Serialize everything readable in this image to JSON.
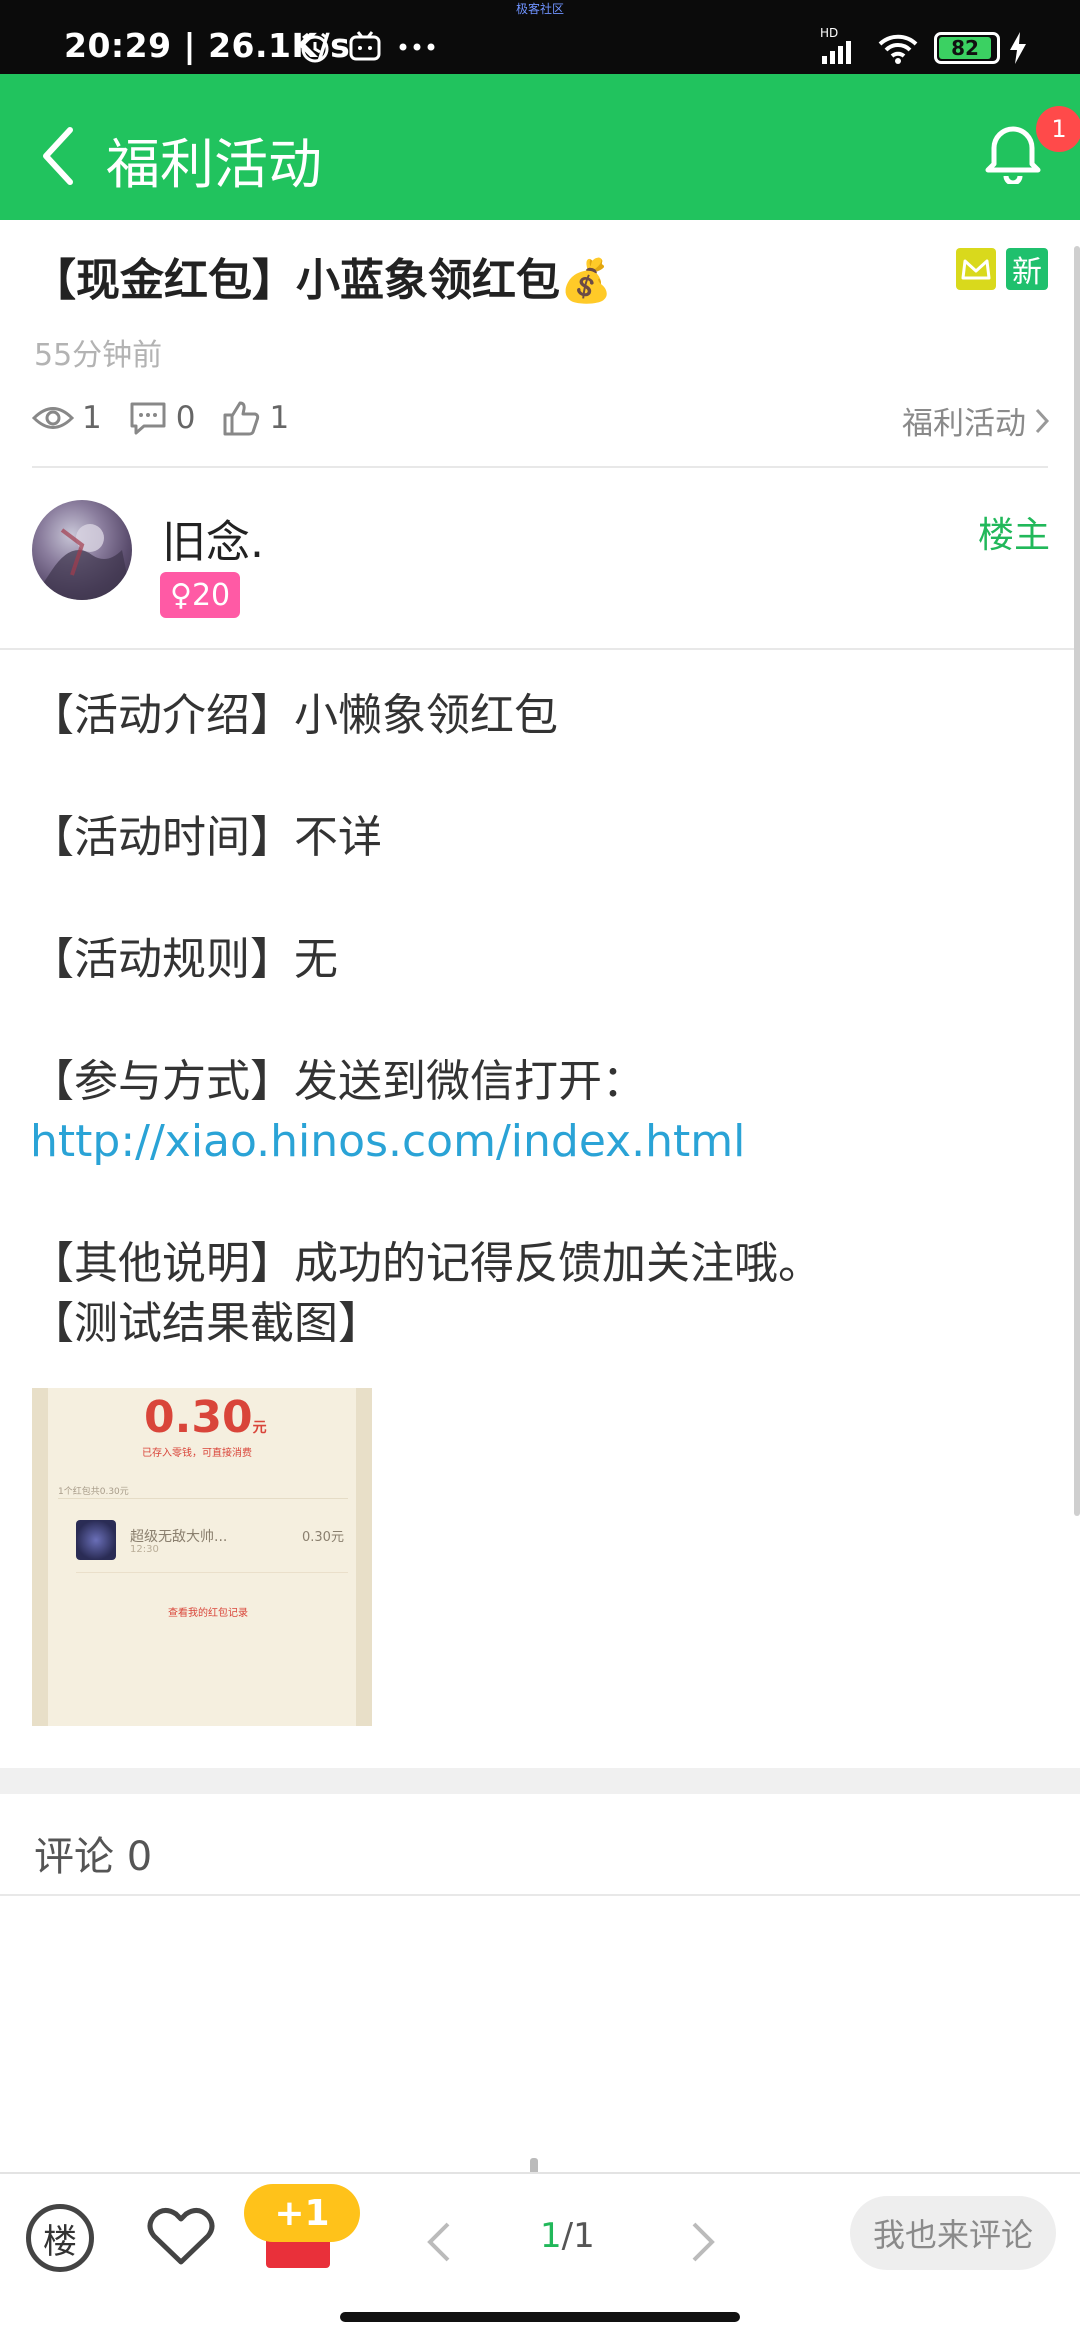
{
  "status_bar": {
    "time": "20:29 | 26.1K/s",
    "tiny_label": "极客社区",
    "battery": "82",
    "network": "HD"
  },
  "header": {
    "title": "福利活动",
    "notification_count": "1"
  },
  "post": {
    "title": "【现金红包】小蓝象领红包",
    "title_emoji": "💰",
    "tag_new": "新",
    "time": "55分钟前",
    "views": "1",
    "comments": "0",
    "likes": "1",
    "category": "福利活动"
  },
  "author": {
    "name": "旧念.",
    "gender_level": "♀20",
    "role": "楼主"
  },
  "content": {
    "intro": "【活动介绍】小懒象领红包",
    "time": "【活动时间】不详",
    "rules": "【活动规则】无",
    "method": "【参与方式】发送到微信打开：",
    "link": "http://xiao.hinos.com/index.html",
    "other": "【其他说明】成功的记得反馈加关注哦。",
    "screenshot_label": "【测试结果截图】"
  },
  "screenshot": {
    "amount": "0.30",
    "unit": "元",
    "sub": "已存入零钱，可直接消费",
    "count": "1个红包共0.30元",
    "name": "超级无敌大帅...",
    "time": "12:30",
    "value": "0.30元",
    "record": "查看我的红包记录"
  },
  "comments_section": {
    "title": "评论 0"
  },
  "bottom_bar": {
    "floor_label": "楼",
    "plus_one": "+1",
    "page_current": "1",
    "page_total": "/1",
    "comment_button": "我也来评论"
  },
  "colors": {
    "header_green": "#21c35e",
    "link_blue": "#2aa3d6",
    "owner_green": "#21b85a",
    "badge_red": "#ff4a4a",
    "gender_pink": "#ff5aa5"
  }
}
